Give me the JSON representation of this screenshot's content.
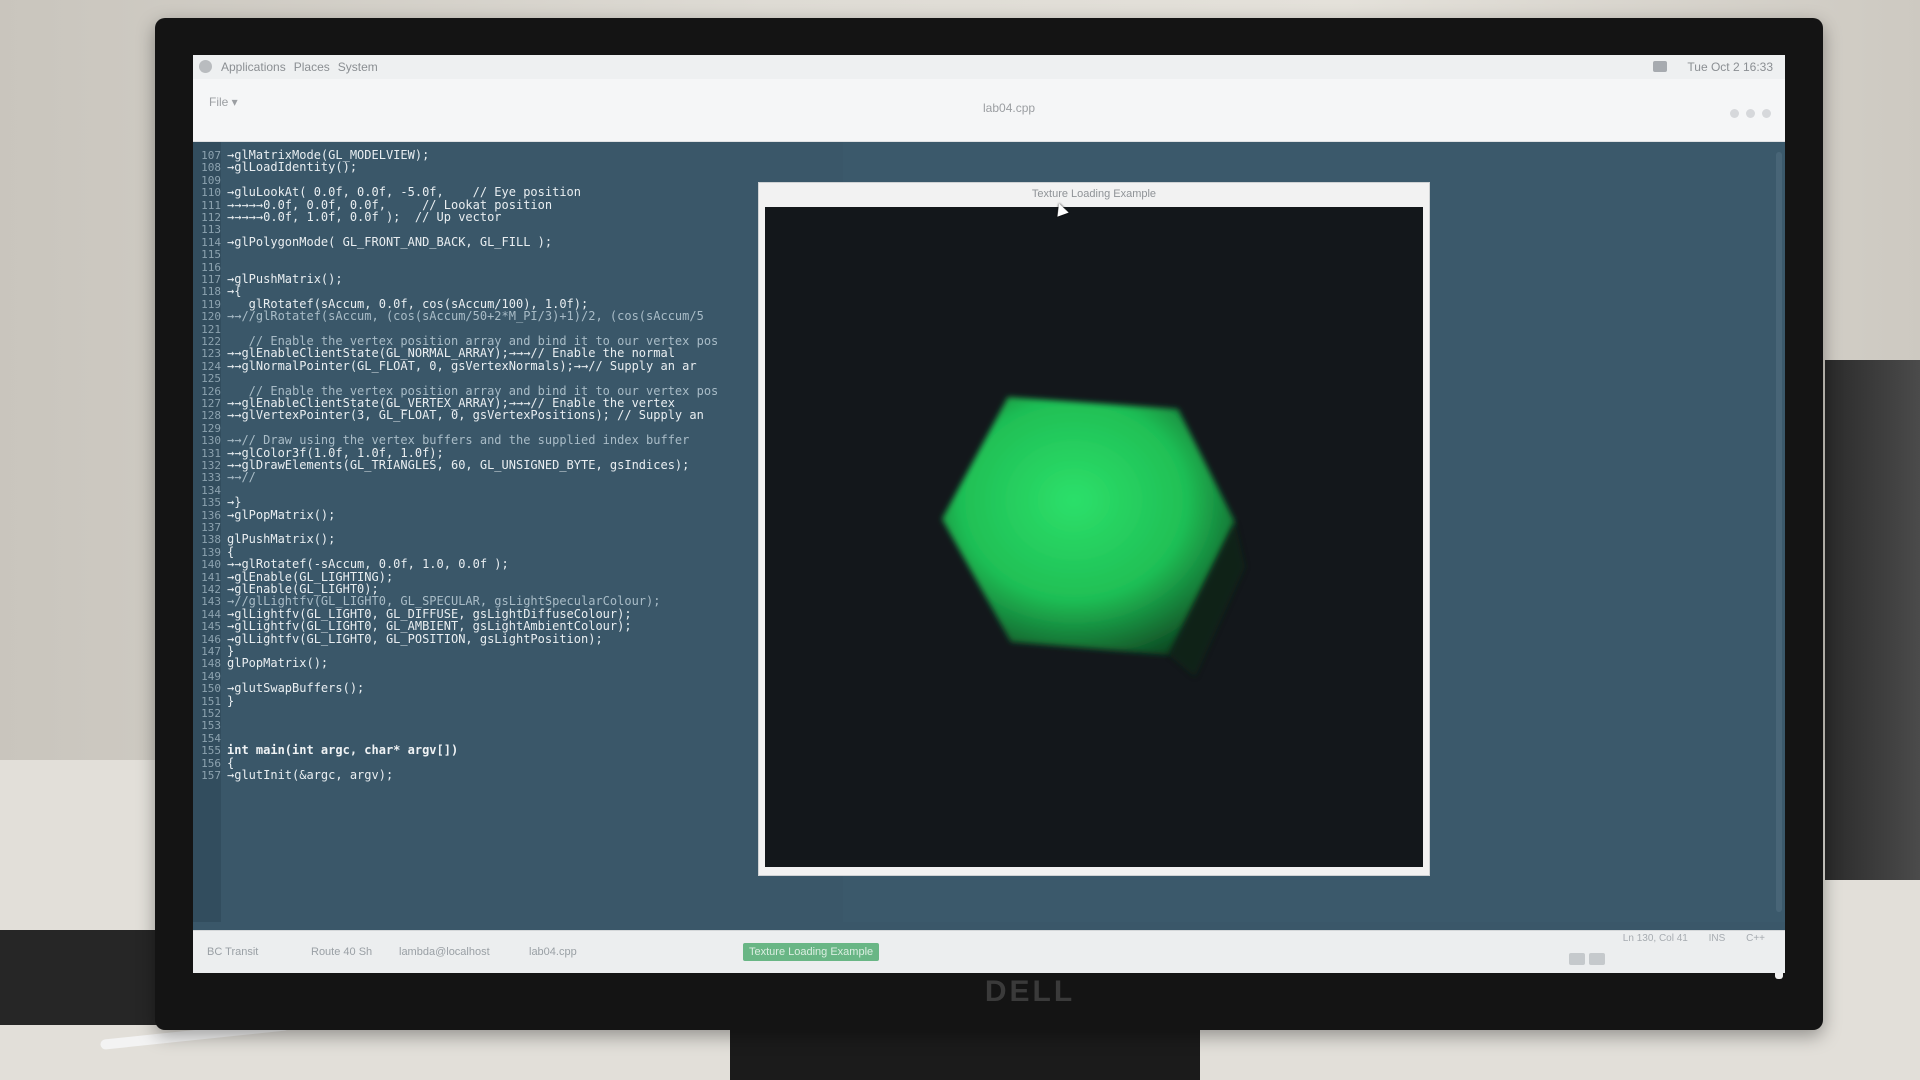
{
  "desktop": {
    "panel_menus": [
      "Applications",
      "Places",
      "System"
    ],
    "clock": "Tue Oct  2  16:33"
  },
  "editor": {
    "file_menu": "File ▾",
    "document_title": "lab04.cpp",
    "code_lines": [
      {
        "n": "107",
        "text": "→glMatrixMode(GL_MODELVIEW);",
        "kind": "code"
      },
      {
        "n": "108",
        "text": "→glLoadIdentity();",
        "kind": "code"
      },
      {
        "n": "109",
        "text": "",
        "kind": "code"
      },
      {
        "n": "110",
        "text": "→gluLookAt( 0.0f, 0.0f, -5.0f,    // Eye position",
        "kind": "code"
      },
      {
        "n": "111",
        "text": "→→→→→0.0f, 0.0f, 0.0f,     // Lookat position",
        "kind": "code"
      },
      {
        "n": "112",
        "text": "→→→→→0.0f, 1.0f, 0.0f );  // Up vector",
        "kind": "code"
      },
      {
        "n": "113",
        "text": "",
        "kind": "code"
      },
      {
        "n": "114",
        "text": "→glPolygonMode( GL_FRONT_AND_BACK, GL_FILL );",
        "kind": "code"
      },
      {
        "n": "115",
        "text": "",
        "kind": "code"
      },
      {
        "n": "116",
        "text": "",
        "kind": "code"
      },
      {
        "n": "117",
        "text": "→glPushMatrix();",
        "kind": "code"
      },
      {
        "n": "118",
        "text": "→{",
        "kind": "code"
      },
      {
        "n": "119",
        "text": "   glRotatef(sAccum, 0.0f, cos(sAccum/100), 1.0f);",
        "kind": "code"
      },
      {
        "n": "120",
        "text": "→→//glRotatef(sAccum, (cos(sAccum/50+2*M_PI/3)+1)/2, (cos(sAccum/5",
        "kind": "comment"
      },
      {
        "n": "121",
        "text": "",
        "kind": "code"
      },
      {
        "n": "122",
        "text": "   // Enable the vertex position array and bind it to our vertex pos",
        "kind": "comment"
      },
      {
        "n": "123",
        "text": "→→glEnableClientState(GL_NORMAL_ARRAY);→→→// Enable the normal",
        "kind": "code"
      },
      {
        "n": "124",
        "text": "→→glNormalPointer(GL_FLOAT, 0, gsVertexNormals);→→// Supply an ar",
        "kind": "code"
      },
      {
        "n": "125",
        "text": "",
        "kind": "code"
      },
      {
        "n": "126",
        "text": "   // Enable the vertex position array and bind it to our vertex pos",
        "kind": "comment"
      },
      {
        "n": "127",
        "text": "→→glEnableClientState(GL_VERTEX_ARRAY);→→→// Enable the vertex",
        "kind": "code"
      },
      {
        "n": "128",
        "text": "→→glVertexPointer(3, GL_FLOAT, 0, gsVertexPositions); // Supply an",
        "kind": "code"
      },
      {
        "n": "129",
        "text": "",
        "kind": "code"
      },
      {
        "n": "130",
        "text": "→→// Draw using the vertex buffers and the supplied index buffer",
        "kind": "comment"
      },
      {
        "n": "131",
        "text": "→→glColor3f(1.0f, 1.0f, 1.0f);",
        "kind": "code"
      },
      {
        "n": "132",
        "text": "→→glDrawElements(GL_TRIANGLES, 60, GL_UNSIGNED_BYTE, gsIndices);",
        "kind": "code"
      },
      {
        "n": "133",
        "text": "→→//",
        "kind": "comment"
      },
      {
        "n": "134",
        "text": "",
        "kind": "code"
      },
      {
        "n": "135",
        "text": "→}",
        "kind": "code"
      },
      {
        "n": "136",
        "text": "→glPopMatrix();",
        "kind": "code"
      },
      {
        "n": "137",
        "text": "",
        "kind": "code"
      },
      {
        "n": "138",
        "text": "glPushMatrix();",
        "kind": "code"
      },
      {
        "n": "139",
        "text": "{",
        "kind": "code"
      },
      {
        "n": "140",
        "text": "→→glRotatef(-sAccum, 0.0f, 1.0, 0.0f );",
        "kind": "code"
      },
      {
        "n": "141",
        "text": "→glEnable(GL_LIGHTING);",
        "kind": "code"
      },
      {
        "n": "142",
        "text": "→glEnable(GL_LIGHT0);",
        "kind": "code"
      },
      {
        "n": "143",
        "text": "→//glLightfv(GL_LIGHT0, GL_SPECULAR, gsLightSpecularColour);",
        "kind": "comment"
      },
      {
        "n": "144",
        "text": "→glLightfv(GL_LIGHT0, GL_DIFFUSE, gsLightDiffuseColour);",
        "kind": "code"
      },
      {
        "n": "145",
        "text": "→glLightfv(GL_LIGHT0, GL_AMBIENT, gsLightAmbientColour);",
        "kind": "code"
      },
      {
        "n": "146",
        "text": "→glLightfv(GL_LIGHT0, GL_POSITION, gsLightPosition);",
        "kind": "code"
      },
      {
        "n": "147",
        "text": "}",
        "kind": "code"
      },
      {
        "n": "148",
        "text": "glPopMatrix();",
        "kind": "code"
      },
      {
        "n": "149",
        "text": "",
        "kind": "code"
      },
      {
        "n": "150",
        "text": "→glutSwapBuffers();",
        "kind": "code"
      },
      {
        "n": "151",
        "text": "}",
        "kind": "code"
      },
      {
        "n": "152",
        "text": "",
        "kind": "code"
      },
      {
        "n": "153",
        "text": "",
        "kind": "code"
      },
      {
        "n": "154",
        "text": "",
        "kind": "code"
      },
      {
        "n": "155",
        "text": "int main(int argc, char* argv[])",
        "kind": "keyword"
      },
      {
        "n": "156",
        "text": "{",
        "kind": "code"
      },
      {
        "n": "157",
        "text": "→glutInit(&argc, argv);",
        "kind": "code"
      }
    ]
  },
  "gl_window": {
    "title": "Texture Loading Example",
    "object_color": "#22c95a",
    "background_color": "#13171b"
  },
  "taskbar": {
    "tasks": [
      "BC Transit",
      "Route 40 Sh",
      "lambda@localhost",
      "lab04.cpp",
      "Texture Loading Example"
    ],
    "active_index": 4,
    "status": [
      "Ln 130, Col 41",
      "INS",
      "C++"
    ]
  },
  "monitor": {
    "brand": "DELL"
  }
}
